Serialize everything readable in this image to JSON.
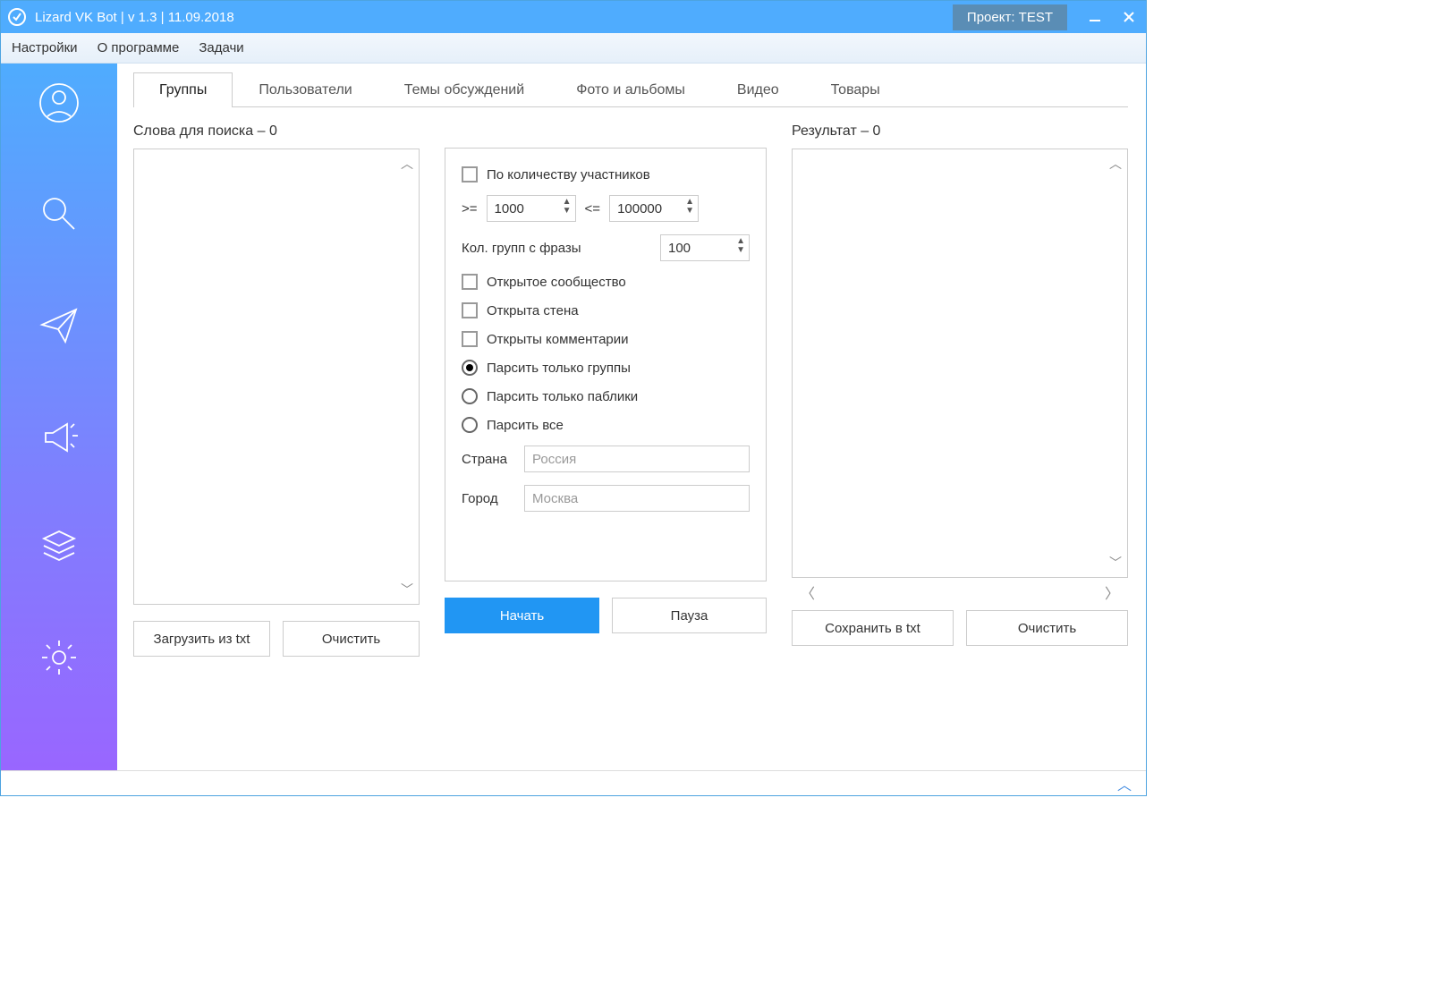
{
  "titlebar": {
    "title": "Lizard VK Bot | v 1.3 | 11.09.2018",
    "project": "Проект: TEST"
  },
  "menubar": {
    "settings": "Настройки",
    "about": "О программе",
    "tasks": "Задачи"
  },
  "tabs": {
    "groups": "Группы",
    "users": "Пользователи",
    "discussions": "Темы обсуждений",
    "photos": "Фото и альбомы",
    "video": "Видео",
    "products": "Товары"
  },
  "left": {
    "label": "Слова для поиска  –  0",
    "load_btn": "Загрузить из txt",
    "clear_btn": "Очистить"
  },
  "settings": {
    "by_members": "По количеству участников",
    "gte": ">=",
    "gte_value": "1000",
    "lte": "<=",
    "lte_value": "100000",
    "groups_per_phrase": "Кол. групп с фразы",
    "groups_per_phrase_value": "100",
    "open_community": "Открытое сообщество",
    "open_wall": "Открыта стена",
    "open_comments": "Открыты комментарии",
    "parse_groups": "Парсить только группы",
    "parse_publics": "Парсить только паблики",
    "parse_all": "Парсить все",
    "country_label": "Страна",
    "country_value": "Россия",
    "city_label": "Город",
    "city_value": "Москва",
    "start_btn": "Начать",
    "pause_btn": "Пауза"
  },
  "right": {
    "label": "Результат – 0",
    "save_btn": "Сохранить в txt",
    "clear_btn": "Очистить"
  }
}
